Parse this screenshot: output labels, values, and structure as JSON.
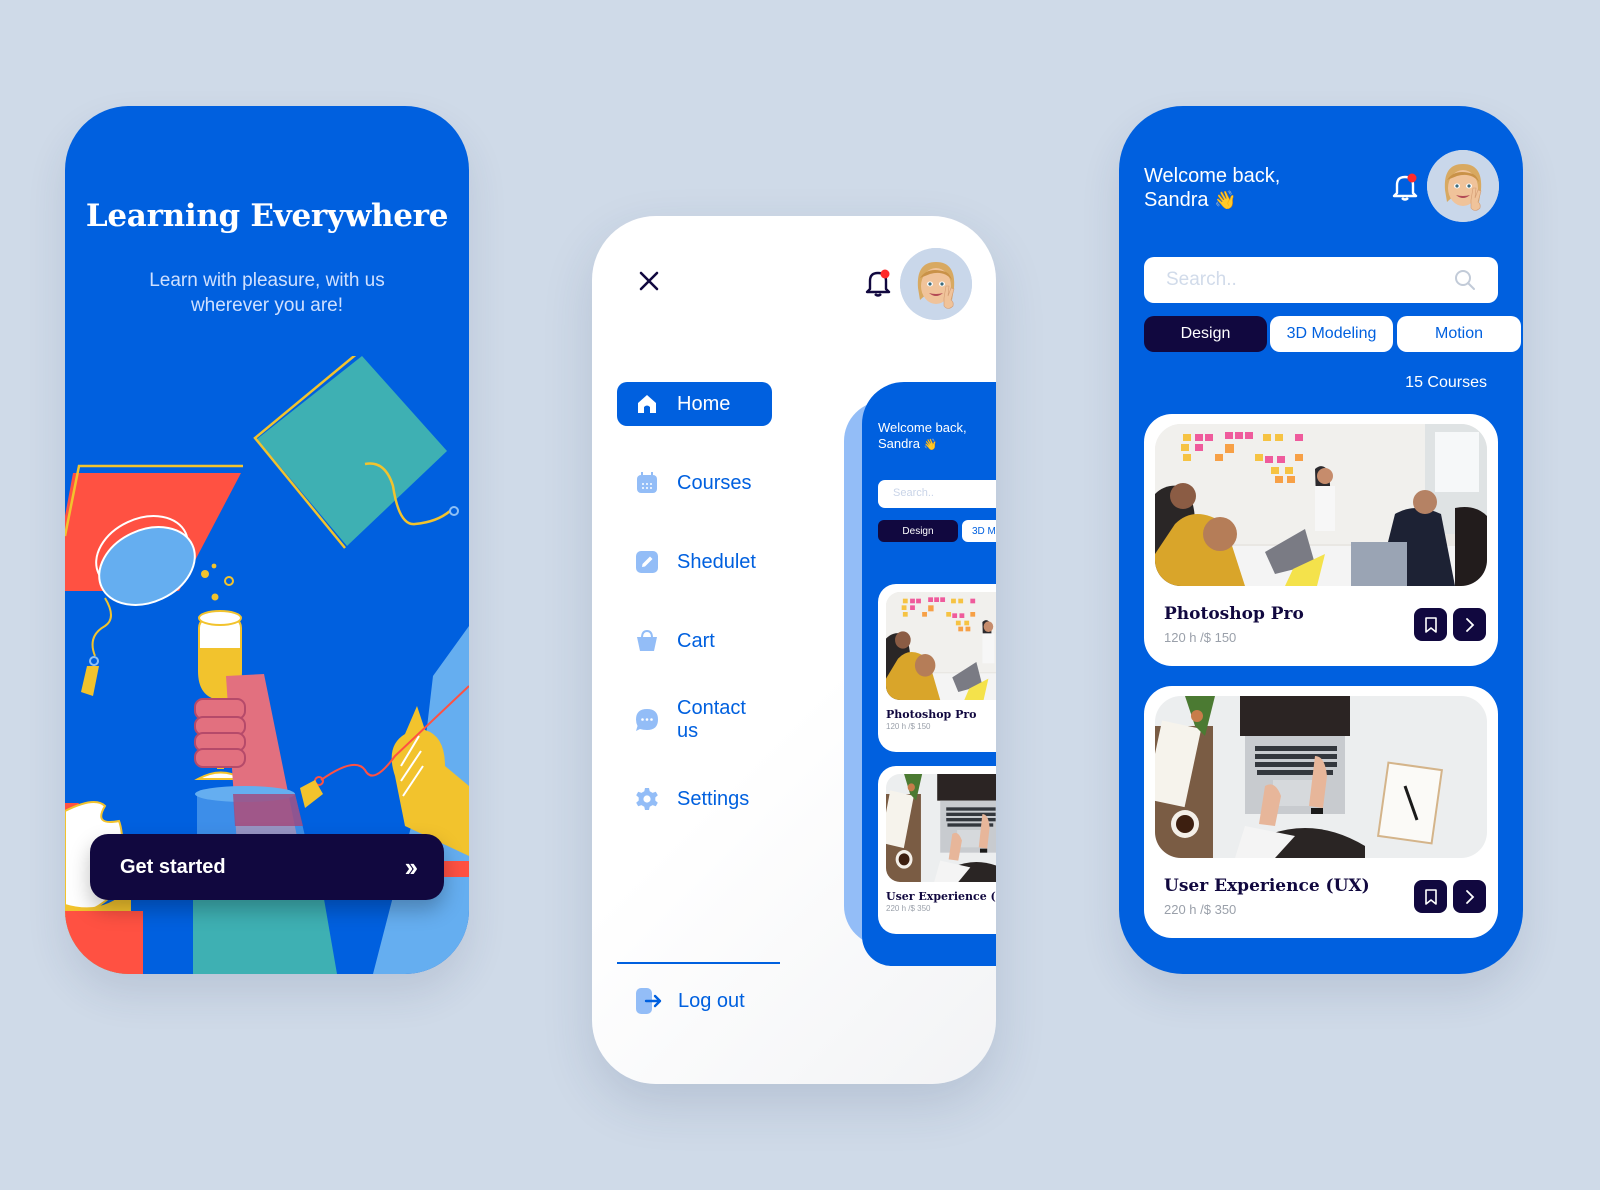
{
  "onboarding": {
    "title": "Learning Everywhere",
    "subtitle": "Learn with pleasure, with us wherever you are!",
    "cta_label": "Get started",
    "cta_icon": "double-chevron-right-icon"
  },
  "menu": {
    "close_icon": "close-icon",
    "notification_icon": "bell-icon",
    "has_notification": true,
    "items": [
      {
        "label": "Home",
        "icon": "home-icon",
        "active": true
      },
      {
        "label": "Courses",
        "icon": "calendar-icon",
        "active": false
      },
      {
        "label": "Shedulet",
        "icon": "edit-icon",
        "active": false
      },
      {
        "label": "Cart",
        "icon": "shopping-bag-icon",
        "active": false
      },
      {
        "label": "Contact us",
        "icon": "chat-icon",
        "active": false
      },
      {
        "label": "Settings",
        "icon": "gear-icon",
        "active": false
      }
    ],
    "logout_label": "Log out",
    "preview": {
      "welcome_line1": "Welcome back,",
      "welcome_line2": "Sandra",
      "search_placeholder": "Search..",
      "tabs": [
        "Design",
        "3D M"
      ],
      "courses": [
        {
          "title": "Photoshop Pro",
          "meta": "120 h /$ 150"
        },
        {
          "title": "User Experience (UX)",
          "meta": "220 h /$ 350"
        }
      ]
    }
  },
  "home": {
    "welcome_line1": "Welcome back,",
    "welcome_line2": "Sandra",
    "wave_emoji": "👋",
    "search_placeholder": "Search..",
    "search_value": "",
    "tabs": [
      {
        "label": "Design",
        "selected": true
      },
      {
        "label": "3D Modeling",
        "selected": false
      },
      {
        "label": "Motion",
        "selected": false
      }
    ],
    "course_count": "15 Courses",
    "courses": [
      {
        "title": "Photoshop Pro",
        "meta": "120 h /$ 150",
        "image": "team-meeting-sticky-notes-photo"
      },
      {
        "title": "User Experience (UX)",
        "meta": "220 h /$ 350",
        "image": "laptop-desk-topdown-photo"
      }
    ]
  },
  "colors": {
    "background": "#cfdae8",
    "brand_blue": "#0060df",
    "navy": "#11083f",
    "light_blue": "#93bdf7",
    "notification_dot": "#ff2a2a",
    "muted_text": "#9aa0aa"
  }
}
